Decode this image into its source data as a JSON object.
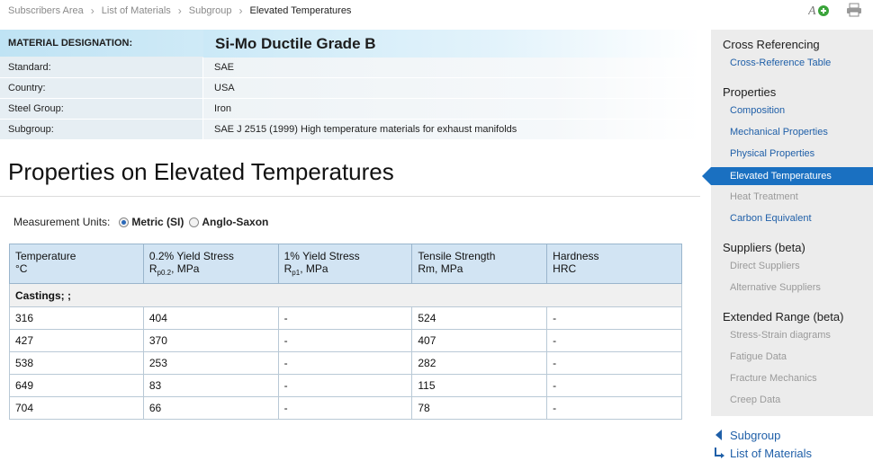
{
  "breadcrumb": {
    "items": [
      "Subscribers Area",
      "List of Materials",
      "Subgroup"
    ],
    "current": "Elevated Temperatures"
  },
  "header": {
    "label": "MATERIAL DESIGNATION:",
    "material": "Si-Mo Ductile Grade B"
  },
  "info": [
    {
      "label": "Standard:",
      "value": "SAE"
    },
    {
      "label": "Country:",
      "value": "USA"
    },
    {
      "label": "Steel Group:",
      "value": "Iron"
    },
    {
      "label": "Subgroup:",
      "value": "SAE J 2515 (1999) High temperature materials for exhaust manifolds"
    }
  ],
  "page_title": "Properties on Elevated Temperatures",
  "units": {
    "label": "Measurement Units:",
    "options": [
      "Metric (SI)",
      "Anglo-Saxon"
    ],
    "selected": "Metric (SI)"
  },
  "table": {
    "columns": [
      {
        "line1": "Temperature",
        "line2": "°C",
        "sub": "",
        "unit": ""
      },
      {
        "line1": "0.2% Yield Stress",
        "line2": "R",
        "sub": "p0.2",
        "unit": ", MPa"
      },
      {
        "line1": "1% Yield Stress",
        "line2": "R",
        "sub": "p1",
        "unit": ", MPa"
      },
      {
        "line1": "Tensile Strength",
        "line2": "Rm, MPa",
        "sub": "",
        "unit": ""
      },
      {
        "line1": "Hardness",
        "line2": "HRC",
        "sub": "",
        "unit": ""
      }
    ],
    "group": "Castings; ;",
    "rows": [
      [
        "316",
        "404",
        "-",
        "524",
        "-"
      ],
      [
        "427",
        "370",
        "-",
        "407",
        "-"
      ],
      [
        "538",
        "253",
        "-",
        "282",
        "-"
      ],
      [
        "649",
        "83",
        "-",
        "115",
        "-"
      ],
      [
        "704",
        "66",
        "-",
        "78",
        "-"
      ]
    ]
  },
  "sidebar": {
    "cross_ref_head": "Cross Referencing",
    "cross_ref_link": "Cross-Reference Table",
    "properties_head": "Properties",
    "composition": "Composition",
    "mechanical": "Mechanical Properties",
    "physical": "Physical Properties",
    "elevated": "Elevated Temperatures",
    "heat": "Heat Treatment",
    "carbon": "Carbon Equivalent",
    "suppliers_head": "Suppliers (beta)",
    "direct": "Direct Suppliers",
    "alternative": "Alternative Suppliers",
    "extended_head": "Extended Range (beta)",
    "stress": "Stress-Strain diagrams",
    "fatigue": "Fatigue Data",
    "fracture": "Fracture Mechanics",
    "creep": "Creep Data"
  },
  "bottom_links": {
    "subgroup": "Subgroup",
    "list": "List of Materials"
  },
  "colors": {
    "accent": "#1a70c1",
    "link": "#1f5fa8",
    "header_bg": "#bfe3f4",
    "table_header_bg": "#d2e4f3"
  }
}
